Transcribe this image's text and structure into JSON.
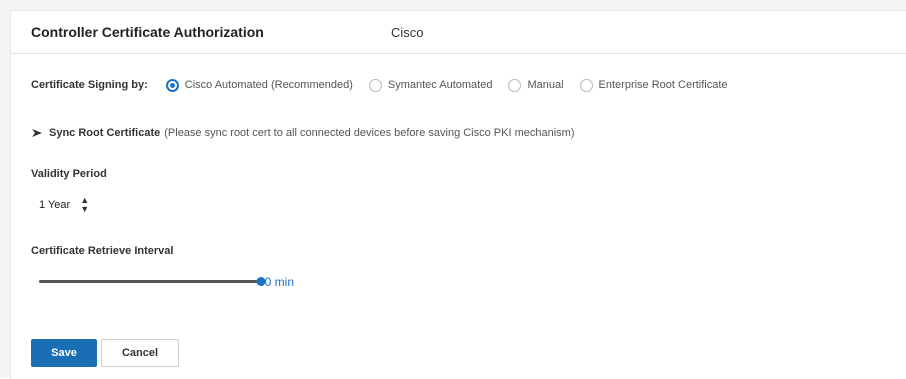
{
  "header": {
    "title": "Controller Certificate Authorization",
    "value": "Cisco"
  },
  "signing": {
    "label": "Certificate Signing by:",
    "options": [
      {
        "label": "Cisco Automated (Recommended)",
        "checked": true
      },
      {
        "label": "Symantec Automated",
        "checked": false
      },
      {
        "label": "Manual",
        "checked": false
      },
      {
        "label": "Enterprise Root Certificate",
        "checked": false
      }
    ]
  },
  "sync": {
    "icon": "chevron-right-icon",
    "title": "Sync Root Certificate",
    "note": "(Please sync root cert to all connected devices before saving Cisco PKI mechanism)"
  },
  "validity": {
    "label": "Validity Period",
    "selected": "1 Year"
  },
  "retrieve": {
    "label": "Certificate Retrieve Interval",
    "value_text": "60 min",
    "fraction": 1.0
  },
  "buttons": {
    "save": "Save",
    "cancel": "Cancel"
  },
  "colors": {
    "accent": "#1a73c8",
    "primary_button": "#1a6fb4"
  }
}
